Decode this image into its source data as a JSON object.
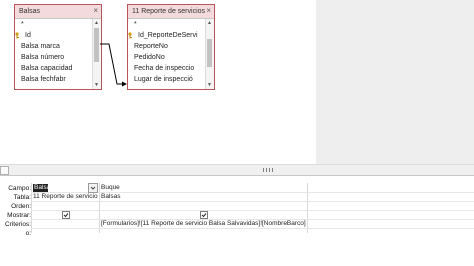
{
  "tables": [
    {
      "title": "Balsas",
      "fields": [
        {
          "label": "*",
          "key": false
        },
        {
          "label": "Id",
          "key": true
        },
        {
          "label": "Balsa marca",
          "key": false
        },
        {
          "label": "Balsa número",
          "key": false
        },
        {
          "label": "Balsa capacidad",
          "key": false
        },
        {
          "label": "Balsa fechfabr",
          "key": false
        }
      ]
    },
    {
      "title": "11 Reporte de servicios",
      "fields": [
        {
          "label": "*",
          "key": false
        },
        {
          "label": "Id_ReporteDeServi",
          "key": true
        },
        {
          "label": "ReporteNo",
          "key": false
        },
        {
          "label": "PedidoNo",
          "key": false
        },
        {
          "label": "Fecha de inspeccio",
          "key": false
        },
        {
          "label": "Lugar de inspecció",
          "key": false
        }
      ]
    }
  ],
  "grid": {
    "row_labels": [
      "Campo:",
      "Tabla:",
      "Orden:",
      "Mostrar:",
      "Criterios:",
      "o:"
    ],
    "columns": [
      {
        "campo": "Balsa",
        "tabla": "11 Reporte de servicio",
        "orden": "",
        "mostrar": true,
        "criterios": "",
        "selected": true
      },
      {
        "campo": "Buque",
        "tabla": "Balsas",
        "orden": "",
        "mostrar": true,
        "criterios": "[Formularios]![11 Reporte de servicio Balsa Salvavidas]![NombreBarco]",
        "selected": false
      }
    ]
  },
  "colors": {
    "table_header": "#f3dadc",
    "table_border": "#b9545a",
    "grid_bg": "#ffffff"
  }
}
